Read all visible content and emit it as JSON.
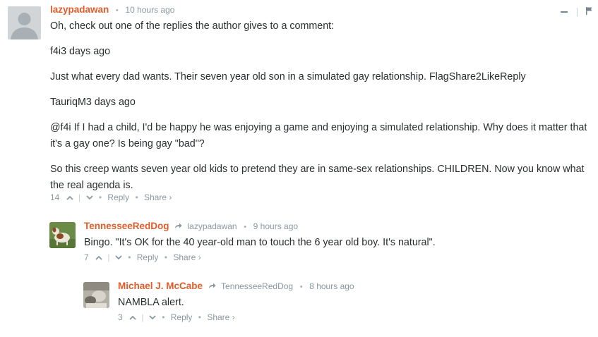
{
  "comments": {
    "main": {
      "author": "lazypadawan",
      "time": "10 hours ago",
      "paragraphs": [
        "Oh, check out one of the replies the author gives to a comment:",
        "f4i3 days ago",
        "Just what every dad wants. Their seven year old son in a simulated gay relationship. FlagShare2LikeReply",
        "TauriqM3 days ago",
        "@f4i If I had a child, I'd be happy he was enjoying a game and enjoying a simulated relationship. Why does it matter that it's a gay one? Is being gay \"bad\"?",
        "So this creep wants seven year old kids to pretend they are in same-sex relationships. CHILDREN. Now you know what the real agenda is."
      ],
      "votes": "14",
      "reply": "Reply",
      "share": "Share ›"
    },
    "reply1": {
      "author": "TennesseeRedDog",
      "parent": "lazypadawan",
      "time": "9 hours ago",
      "text": "Bingo. \"It's OK for the 40 year-old man to touch the 6 year old boy. It's natural\".",
      "votes": "7",
      "reply": "Reply",
      "share": "Share ›"
    },
    "reply2": {
      "author": "Michael J. McCabe",
      "parent": "TennesseeRedDog",
      "time": "8 hours ago",
      "text": "NAMBLA alert.",
      "votes": "3",
      "reply": "Reply",
      "share": "Share ›"
    }
  },
  "icons": {
    "collapse": "minus-icon",
    "flag": "flag-icon",
    "upvote": "chevron-up-icon",
    "downvote": "chevron-down-icon",
    "reply_arrow": "share-arrow-icon"
  },
  "colors": {
    "author": "#e05d2b",
    "meta": "#8a979e",
    "text": "#2a2e2e"
  }
}
